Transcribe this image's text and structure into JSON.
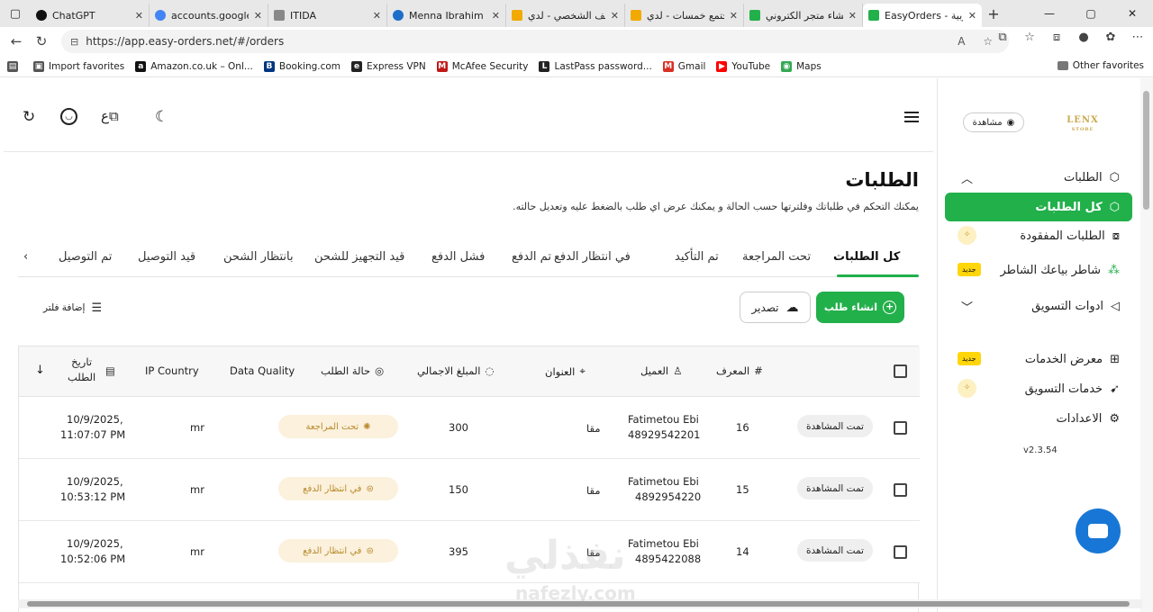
{
  "browser": {
    "tabs": [
      {
        "title": "ChatGPT",
        "color": "#111111"
      },
      {
        "title": "accounts.google.co",
        "color": "#4285f4"
      },
      {
        "title": "ITIDA",
        "color": "#888888"
      },
      {
        "title": "Menna Ibrahim | مستقل",
        "color": "#1d6ec9"
      },
      {
        "title": "الملف الشخصي - لدي",
        "color": "#f2a900"
      },
      {
        "title": "مجتمع خمسات - لدي",
        "color": "#f2a900"
      },
      {
        "title": "انشاء متجر الكتروني",
        "color": "#22b04b"
      },
      {
        "title": "EasyOrders - عربية",
        "color": "#22b04b"
      }
    ],
    "url": "https://app.easy-orders.net/#/orders",
    "bookmarks": [
      {
        "label": "Import favorites",
        "color": "#555555",
        "glyph": "▣"
      },
      {
        "label": "Amazon.co.uk – Onl...",
        "color": "#111111",
        "glyph": "a"
      },
      {
        "label": "Booking.com",
        "color": "#003580",
        "glyph": "B"
      },
      {
        "label": "Express VPN",
        "color": "#222222",
        "glyph": "e"
      },
      {
        "label": "McAfee Security",
        "color": "#c01818",
        "glyph": "M"
      },
      {
        "label": "LastPass password...",
        "color": "#222222",
        "glyph": "L"
      },
      {
        "label": "Gmail",
        "color": "#d93025",
        "glyph": "M"
      },
      {
        "label": "YouTube",
        "color": "#ff0000",
        "glyph": "▶"
      },
      {
        "label": "Maps",
        "color": "#34a853",
        "glyph": "◉"
      }
    ],
    "other_favorites": "Other favorites"
  },
  "header": {
    "title": "الطلبات",
    "subtitle": "يمكنك التحكم في طلباتك وفلترتها حسب الحالة و يمكنك عرض اي طلب بالضغط عليه وتعديل حالته."
  },
  "order_tabs": [
    "كل الطلبات",
    "تحت المراجعة",
    "تم التأكيد",
    "في انتظار الدفع",
    "تم الدفع",
    "فشل الدفع",
    "قيد التجهيز للشحن",
    "بانتظار الشحن",
    "قيد التوصيل",
    "تم التوصيل"
  ],
  "actions": {
    "create": "انشاء طلب",
    "export": "تصدير",
    "filter": "إضافة فلتر"
  },
  "table": {
    "headers": {
      "id": "المعرف",
      "customer": "العميل",
      "address": "العنوان",
      "total": "المبلغ الاجمالي",
      "status": "حالة الطلب",
      "quality": "Data Quality",
      "country": "IP Country",
      "date_line1": "تاريخ",
      "date_line2": "الطلب"
    },
    "rows": [
      {
        "seen": "تمت المشاهدة",
        "id": "16",
        "name": "Fatimetou Ebi",
        "phone": "48929542201",
        "address": "مقا",
        "total": "300",
        "status": "تحت المراجعة",
        "country": "mr",
        "date": "10/9/2025,",
        "time": "11:07:07 PM"
      },
      {
        "seen": "تمت المشاهدة",
        "id": "15",
        "name": "Fatimetou Ebi",
        "phone": "4892954220",
        "address": "مقا",
        "total": "150",
        "status": "في انتظار الدفع",
        "country": "mr",
        "date": "10/9/2025,",
        "time": "10:53:12 PM"
      },
      {
        "seen": "تمت المشاهدة",
        "id": "14",
        "name": "Fatimetou Ebi",
        "phone": "4895422088",
        "address": "مقا",
        "total": "395",
        "status": "في انتظار الدفع",
        "country": "mr",
        "date": "10/9/2025,",
        "time": "10:52:06 PM"
      }
    ]
  },
  "sidebar": {
    "preview": "مشاهدة",
    "logo": "LENX",
    "logo_sub": "STORE",
    "items": [
      {
        "label": "الطلبات"
      },
      {
        "label": "كل الطلبات"
      },
      {
        "label": "الطلبات المفقودة"
      },
      {
        "label": "شاطر بياعك الشاطر",
        "tag": "جديد"
      },
      {
        "label": "ادوات التسويق"
      },
      {
        "label": "معرض الخدمات",
        "tag": "جديد"
      },
      {
        "label": "خدمات التسويق"
      },
      {
        "label": "الاعدادات"
      }
    ],
    "version": "v2.3.54"
  },
  "watermark": {
    "main": "نفذلي",
    "sub": "nafezly.com"
  },
  "colors": {
    "accent": "#22b04b",
    "status_bg": "#fbf1dc",
    "status_text": "#b98a2c",
    "new_tag": "#ffd60a",
    "chat": "#1877d6"
  }
}
